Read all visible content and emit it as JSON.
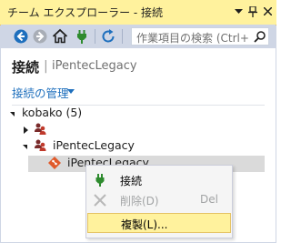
{
  "window": {
    "title": "チーム エクスプローラー - 接続",
    "buttons": {
      "dropdown": "▼",
      "pin": "📌",
      "close": "✕"
    }
  },
  "toolbar": {
    "icons": [
      "back-icon",
      "forward-icon",
      "home-icon",
      "connect-icon",
      "refresh-icon"
    ],
    "search_placeholder": "作業項目の検索 (Ctrl+",
    "search_icon": "search-icon"
  },
  "page": {
    "title": "接続",
    "separator": "|",
    "server": "iPentecLegacy",
    "manage_link": "接続の管理"
  },
  "tree": {
    "root": "kobako (5)",
    "collection_1": "",
    "collection_2": "iPentecLegacy",
    "project": "iPentecLegacy"
  },
  "context_menu": {
    "items": [
      {
        "label": "接続",
        "shortcut": "",
        "icon": "connect-icon",
        "enabled": true,
        "highlighted": false
      },
      {
        "label": "削除(D)",
        "shortcut": "Del",
        "icon": "delete-icon",
        "enabled": false,
        "highlighted": false
      },
      {
        "label": "複製(L)...",
        "shortcut": "",
        "icon": "",
        "enabled": true,
        "highlighted": true
      }
    ]
  },
  "colors": {
    "title_bg": "#fff29d",
    "frame_bg": "#cfd6e5",
    "link": "#1e6fbd",
    "selection": "#dadada",
    "menu_highlight": "#fff29d"
  }
}
